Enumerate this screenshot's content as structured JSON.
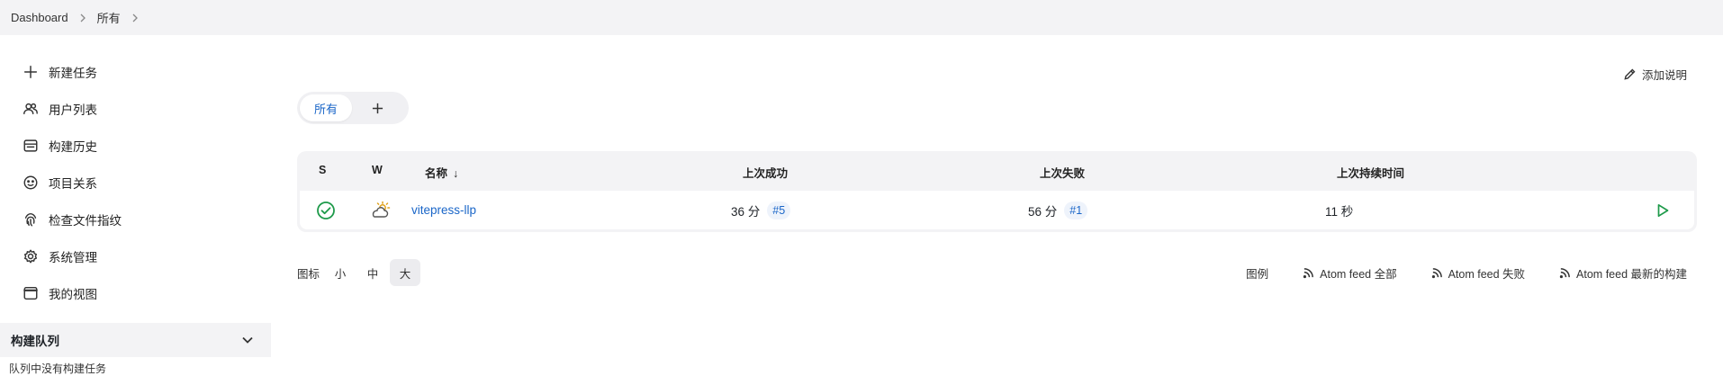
{
  "breadcrumb": {
    "items": [
      "Dashboard",
      "所有"
    ]
  },
  "sidebar": {
    "items": [
      {
        "label": "新建任务",
        "icon": "plus-icon"
      },
      {
        "label": "用户列表",
        "icon": "users-icon"
      },
      {
        "label": "构建历史",
        "icon": "history-icon"
      },
      {
        "label": "项目关系",
        "icon": "relationship-icon"
      },
      {
        "label": "检查文件指纹",
        "icon": "fingerprint-icon"
      },
      {
        "label": "系统管理",
        "icon": "gear-icon"
      },
      {
        "label": "我的视图",
        "icon": "window-icon"
      }
    ],
    "queue": {
      "title": "构建队列",
      "empty_text": "队列中没有构建任务"
    }
  },
  "main": {
    "add_description": "添加说明",
    "tabs": [
      {
        "label": "所有",
        "active": true
      }
    ],
    "table": {
      "headers": {
        "s": "S",
        "w": "W",
        "name": "名称",
        "sort_indicator": "↓",
        "last_success": "上次成功",
        "last_failure": "上次失败",
        "last_duration": "上次持续时间"
      },
      "rows": [
        {
          "name": "vitepress-llp",
          "status": "success",
          "weather": "partly-sunny",
          "last_success_time": "36 分",
          "last_success_build": "#5",
          "last_failure_time": "56 分",
          "last_failure_build": "#1",
          "last_duration": "11 秒"
        }
      ]
    },
    "icon_size": {
      "label": "图标",
      "options": [
        "小",
        "中",
        "大"
      ],
      "selected": "大"
    },
    "feeds": {
      "legend": "图例",
      "all": "Atom feed 全部",
      "failed": "Atom feed 失败",
      "latest": "Atom feed 最新的构建"
    }
  },
  "colors": {
    "link": "#1a66c8",
    "success": "#1e9a4a",
    "run": "#1e9a4a",
    "bar_bg": "#f3f3f5"
  }
}
